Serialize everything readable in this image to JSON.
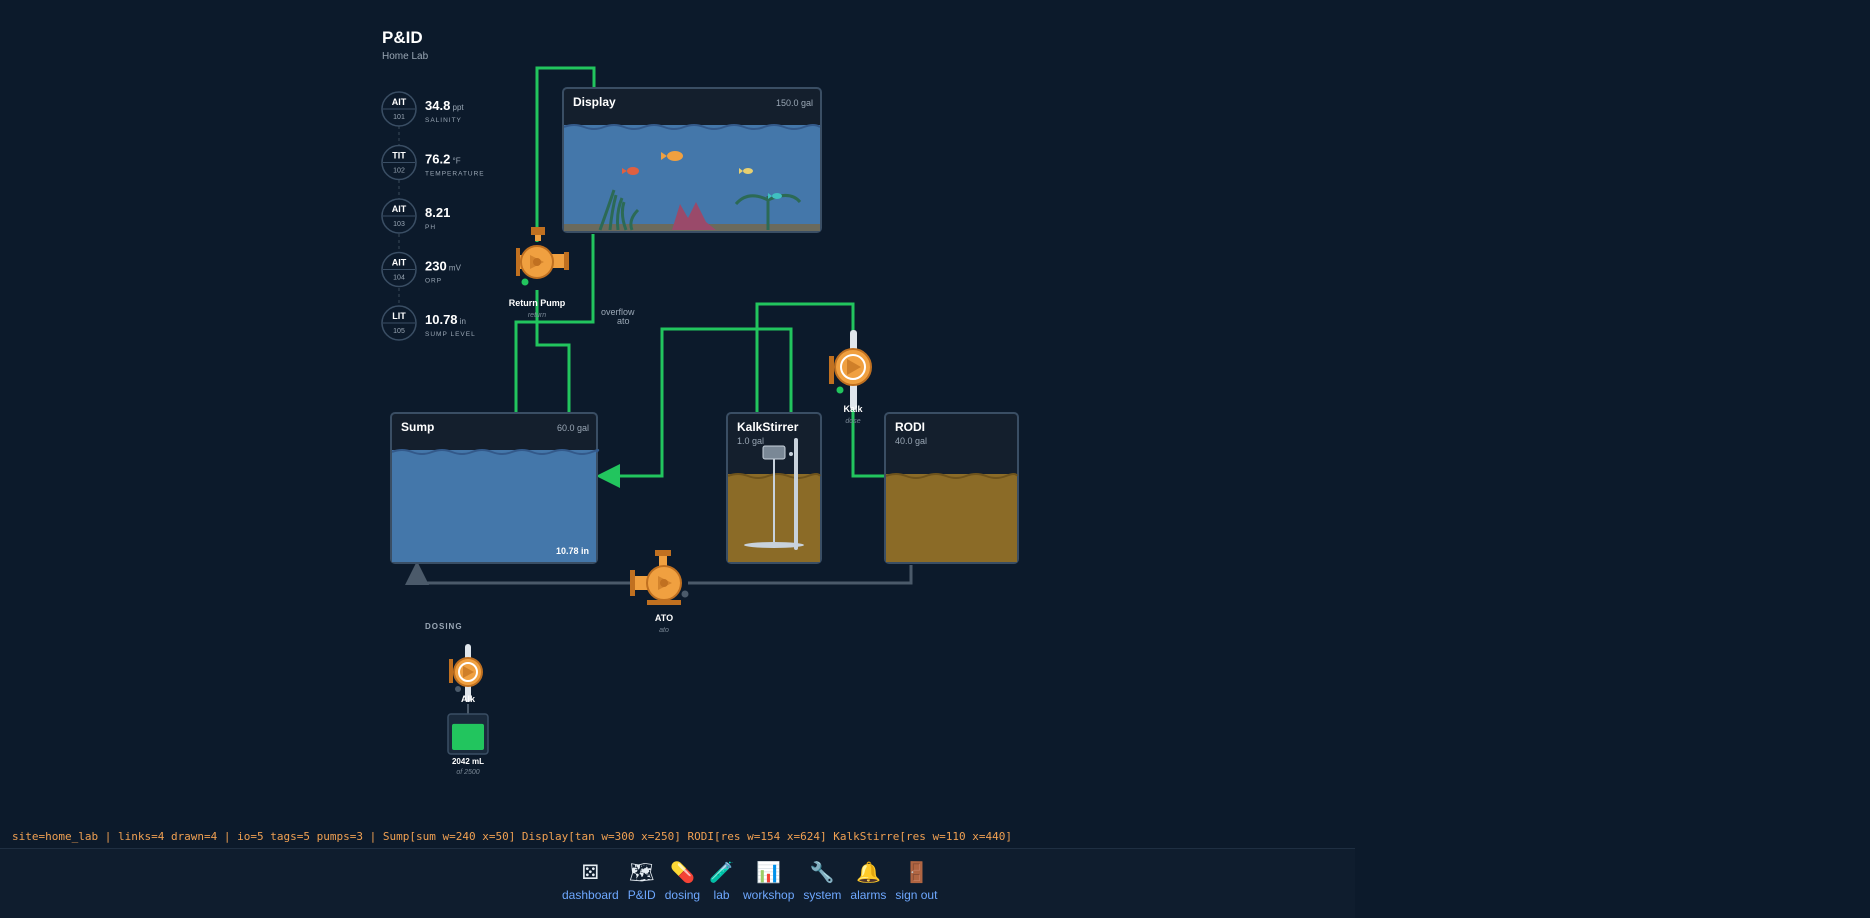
{
  "header": {
    "title": "P&ID",
    "subtitle": "Home Lab"
  },
  "instruments": [
    {
      "tag": "AIT",
      "num": "101",
      "value": "34.8",
      "unit": "ppt",
      "label": "SALINITY"
    },
    {
      "tag": "TIT",
      "num": "102",
      "value": "76.2",
      "unit": "°F",
      "label": "TEMPERATURE"
    },
    {
      "tag": "AIT",
      "num": "103",
      "value": "8.21",
      "unit": "",
      "label": "PH"
    },
    {
      "tag": "AIT",
      "num": "104",
      "value": "230",
      "unit": "mV",
      "label": "ORP"
    },
    {
      "tag": "LIT",
      "num": "105",
      "value": "10.78",
      "unit": "in",
      "label": "SUMP LEVEL"
    }
  ],
  "tanks": {
    "display": {
      "name": "Display",
      "volume": "150.0 gal"
    },
    "sump": {
      "name": "Sump",
      "volume": "60.0 gal",
      "level": "10.78 in"
    },
    "kalkstirrer": {
      "name": "KalkStirrer",
      "volume": "1.0 gal"
    },
    "rodi": {
      "name": "RODI",
      "volume": "40.0 gal"
    }
  },
  "pumps": {
    "return": {
      "name": "Return Pump",
      "role": "return"
    },
    "kalk": {
      "name": "Kalk",
      "role": "dose"
    },
    "ato": {
      "name": "ATO",
      "role": "ato"
    }
  },
  "links": {
    "overflow": "overflow",
    "ato": "ato"
  },
  "dosing": {
    "heading": "DOSING",
    "pump": "Alk",
    "amount": "2042 mL",
    "capacity": "of 2500",
    "fill_fraction": 0.817
  },
  "status_line": "site=home_lab | links=4 drawn=4 | io=5 tags=5 pumps=3 | Sump[sum w=240 x=50] Display[tan w=300 x=250] RODI[res w=154 x=624] KalkStirre[res w=110 x=440]",
  "nav": [
    {
      "label": "dashboard",
      "icon": "dice-icon",
      "glyph": "⚄"
    },
    {
      "label": "P&ID",
      "icon": "map-icon",
      "glyph": "🗺"
    },
    {
      "label": "dosing",
      "icon": "pill-icon",
      "glyph": "💊"
    },
    {
      "label": "lab",
      "icon": "test-tube-icon",
      "glyph": "🧪"
    },
    {
      "label": "workshop",
      "icon": "bar-chart-icon",
      "glyph": "📊"
    },
    {
      "label": "system",
      "icon": "wrench-icon",
      "glyph": "🔧"
    },
    {
      "label": "alarms",
      "icon": "bell-icon",
      "glyph": "🔔"
    },
    {
      "label": "sign out",
      "icon": "door-icon",
      "glyph": "🚪"
    }
  ],
  "colors": {
    "background": "#0c1a2b",
    "pipe_active": "#22c55e",
    "pipe_inactive": "#4b5a6a",
    "water": "#4477aa",
    "kalk_water": "#8b6b27",
    "pump": "#f0a040",
    "nav_label": "#6ea8ff",
    "status_text": "#f0a052"
  }
}
